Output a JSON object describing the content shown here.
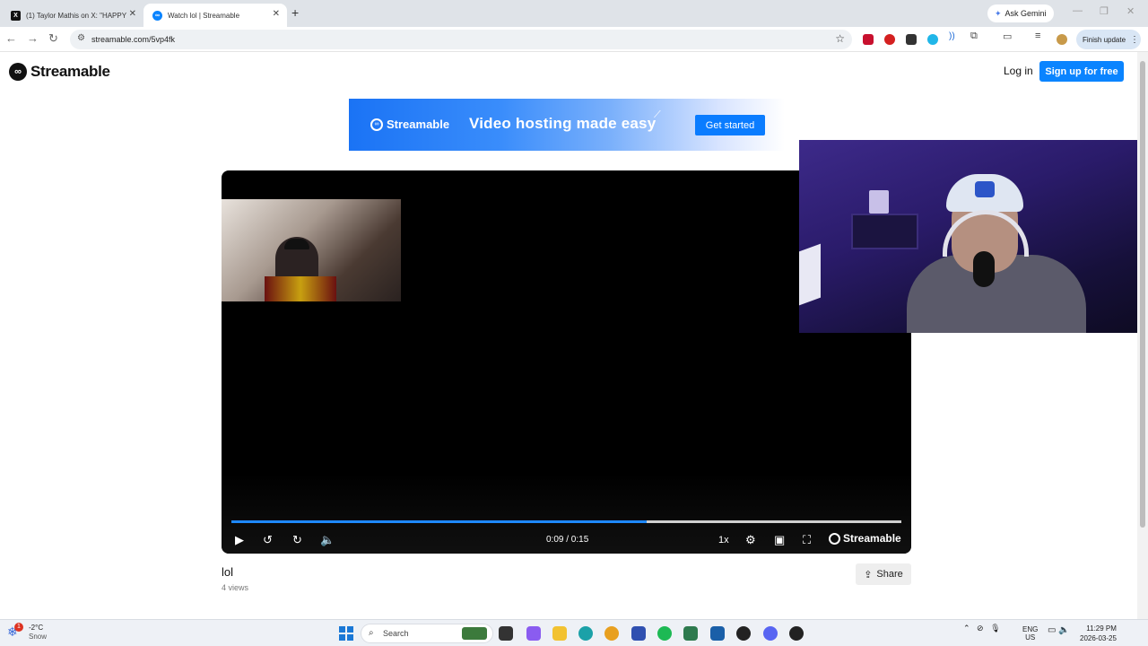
{
  "browser": {
    "tabs": [
      {
        "title": "(1) Taylor Mathis on X: \"HAPPY",
        "active": false,
        "icon": "x-logo-icon"
      },
      {
        "title": "Watch lol | Streamable",
        "active": true,
        "icon": "streamable-icon"
      }
    ],
    "ask_gemini": "Ask Gemini",
    "url": "streamable.com/5vp4fk",
    "finish_update": "Finish update"
  },
  "site": {
    "brand": "Streamable",
    "login": "Log in",
    "signup": "Sign up for free"
  },
  "banner": {
    "brand": "Streamable",
    "tagline": "Video hosting made easy",
    "cta": "Get started"
  },
  "player": {
    "current_time": "0:09",
    "duration": "0:15",
    "time_display": "0:09 / 0:15",
    "progress_fraction": 0.62,
    "speed": "1x",
    "brand": "Streamable"
  },
  "video": {
    "title": "lol",
    "views": "4 views",
    "share": "Share"
  },
  "taskbar": {
    "weather_temp": "-2°C",
    "weather_cond": "Snow",
    "weather_badge": "1",
    "search_placeholder": "Search",
    "lang_top": "ENG",
    "lang_bottom": "US",
    "time": "11:29 PM",
    "date": "2026-03-25"
  },
  "colors": {
    "accent": "#0a84ff",
    "progress": "#1e88ff"
  }
}
